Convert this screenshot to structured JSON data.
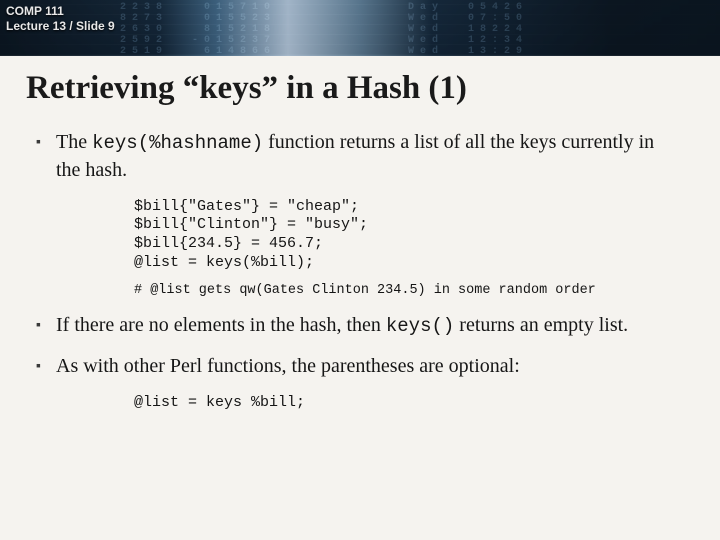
{
  "header": {
    "course": "COMP 111",
    "lecture": "Lecture 13 / Slide 9"
  },
  "title": "Retrieving “keys” in a Hash  (1)",
  "bullets": [
    {
      "pre": "The ",
      "mono": "keys(%hashname)",
      "post": " function returns a list of all the keys currently in the hash."
    },
    {
      "pre": "If there are no elements in the hash, then ",
      "mono": "keys()",
      "post": " returns an empty list."
    },
    {
      "pre": "As with other Perl functions, the parentheses are optional:",
      "mono": "",
      "post": ""
    }
  ],
  "code1": "$bill{\"Gates\"} = \"cheap\";\n$bill{\"Clinton\"} = \"busy\";\n$bill{234.5} = 456.7;\n@list = keys(%bill);",
  "code1_comment": "# @list gets qw(Gates Clinton 234.5) in some random order",
  "code2": "@list = keys %bill;",
  "banner_noise": "2238   015710           Day  05426\n8273   015523           Wed  07:50\n2630   815218           Wed  18224\n2592  -015237           Wed  12:34\n2519   614866           Wed  13:29"
}
